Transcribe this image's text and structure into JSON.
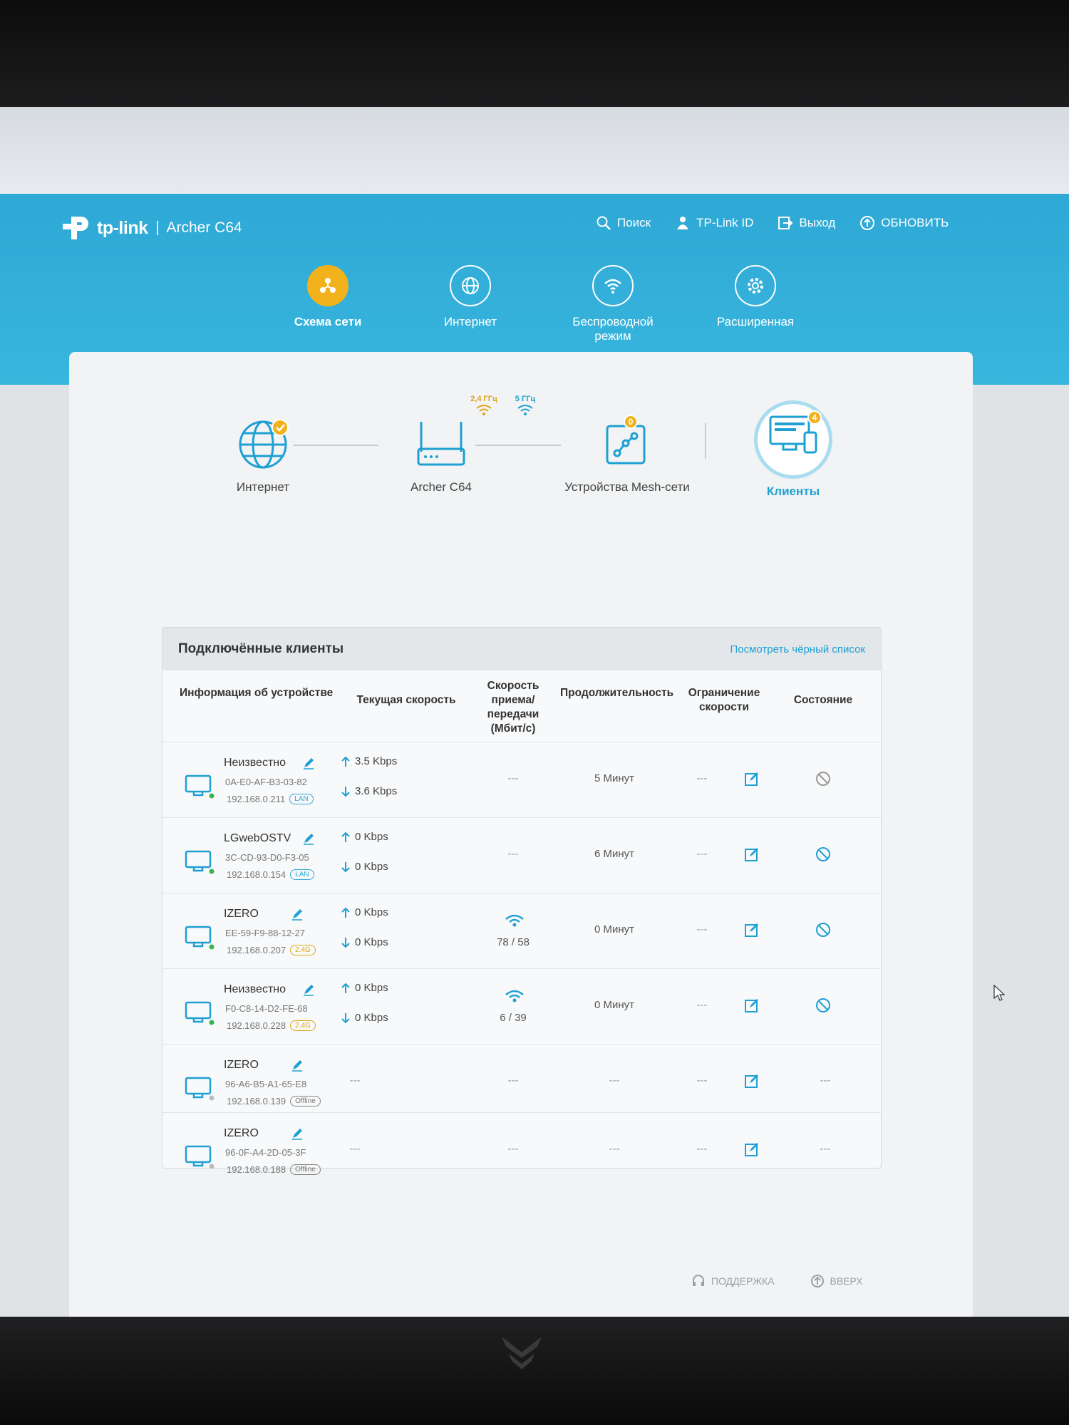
{
  "brand": {
    "logo_text": "tp-link",
    "model": "Archer C64"
  },
  "top_actions": [
    {
      "label": "Поиск",
      "icon": "search-icon"
    },
    {
      "label": "TP-Link ID",
      "icon": "user-icon"
    },
    {
      "label": "Выход",
      "icon": "logout-icon"
    },
    {
      "label": "ОБНОВИТЬ",
      "icon": "update-icon"
    }
  ],
  "nav": [
    {
      "label": "Схема сети",
      "icon": "network-map-icon",
      "active": true
    },
    {
      "label": "Интернет",
      "icon": "globe-icon"
    },
    {
      "label": "Беспроводной режим",
      "icon": "wireless-icon"
    },
    {
      "label": "Расширенная",
      "icon": "gear-icon"
    }
  ],
  "topology": {
    "internet": "Интернет",
    "router": "Archer C64",
    "band_24": "2,4 ГГц",
    "band_5": "5 ГГц",
    "mesh": "Устройства Mesh-сети",
    "mesh_count": "0",
    "clients": "Клиенты",
    "clients_count": "4"
  },
  "clients_table": {
    "title": "Подключённые клиенты",
    "blacklist_link": "Посмотреть чёрный список",
    "headers": {
      "device_info": "Информация об устройстве",
      "current_speed": "Текущая скорость",
      "rate": "Скорость приема/передачи (Мбит/с)",
      "duration": "Продолжительность",
      "limit": "Ограничение скорости",
      "status": "Состояние"
    },
    "rows": [
      {
        "name": "Неизвестно",
        "mac": "0A-E0-AF-B3-03-82",
        "ip": "192.168.0.211",
        "conn": "LAN",
        "up": "3.5 Kbps",
        "down": "3.6 Kbps",
        "rate": "---",
        "duration": "5 Минут",
        "limit": "---",
        "online": true
      },
      {
        "name": "LGwebOSTV",
        "mac": "3C-CD-93-D0-F3-05",
        "ip": "192.168.0.154",
        "conn": "LAN",
        "up": "0 Kbps",
        "down": "0 Kbps",
        "rate": "---",
        "duration": "6 Минут",
        "limit": "---",
        "online": true
      },
      {
        "name": "IZERO",
        "mac": "EE-59-F9-88-12-27",
        "ip": "192.168.0.207",
        "conn": "2.4G",
        "up": "0 Kbps",
        "down": "0 Kbps",
        "rate": "78 / 58",
        "duration": "0 Минут",
        "limit": "---",
        "online": true
      },
      {
        "name": "Неизвестно",
        "mac": "F0-C8-14-D2-FE-68",
        "ip": "192.168.0.228",
        "conn": "2.4G",
        "up": "0 Kbps",
        "down": "0 Kbps",
        "rate": "6 / 39",
        "duration": "0 Минут",
        "limit": "---",
        "online": true
      },
      {
        "name": "IZERO",
        "mac": "96-A6-B5-A1-65-E8",
        "ip": "192.168.0.139",
        "conn": "Offline",
        "speed": "---",
        "rate": "---",
        "duration": "---",
        "limit": "---",
        "status": "---",
        "online": false
      },
      {
        "name": "IZERO",
        "mac": "96-0F-A4-2D-05-3F",
        "ip": "192.168.0.188",
        "conn": "Offline",
        "speed": "---",
        "rate": "---",
        "duration": "---",
        "limit": "---",
        "status": "---",
        "online": false
      }
    ]
  },
  "footer": [
    {
      "label": "ПОДДЕРЖКА",
      "icon": "support-icon"
    },
    {
      "label": "ВВЕРХ",
      "icon": "arrow-up-icon"
    }
  ],
  "colors": {
    "header": "#2ea8d5",
    "accent": "#1ea0d2",
    "active": "#f2b21b"
  }
}
